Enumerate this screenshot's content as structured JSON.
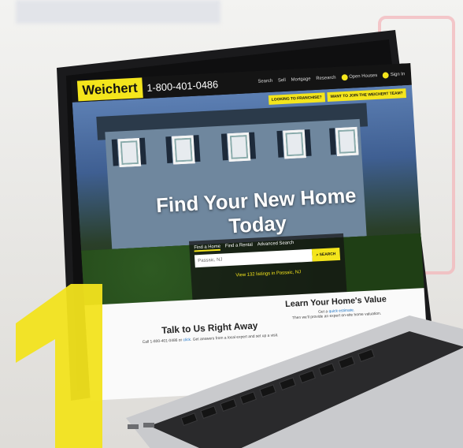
{
  "step_number": "1",
  "site": {
    "logo": "Weichert",
    "phone": "1-800-401-0486",
    "nav": [
      "Search",
      "Sell",
      "Mortgage",
      "Research"
    ],
    "nav_open_houses": "Open Houses",
    "nav_sign_in": "Sign In",
    "promo": [
      "LOOKING TO FRANCHISE?",
      "WANT TO JOIN THE WEICHERT TEAM?"
    ],
    "headline": "Find Your New Home Today",
    "search_tabs": [
      "Find a Home",
      "Find a Rental",
      "Advanced Search"
    ],
    "search_value": "Passaic, NJ",
    "search_button": "SEARCH",
    "listings_link": "View 132 listings in Passaic, NJ",
    "talk_title": "Talk to Us Right Away",
    "talk_text_call": "Call 1-800-401-0486 or",
    "talk_text_link": "click",
    "talk_text_rest": "Get answers from a local expert and set up a visit.",
    "learn_title": "Learn Your Home's Value",
    "learn_text_1": "Get a",
    "learn_text_link": "quick estimate.",
    "learn_text_2": "Then we'll provide an expert on-site home valuation."
  },
  "colors": {
    "brand_yellow": "#f4e51c",
    "dark": "#141414",
    "link": "#1b73c6"
  }
}
